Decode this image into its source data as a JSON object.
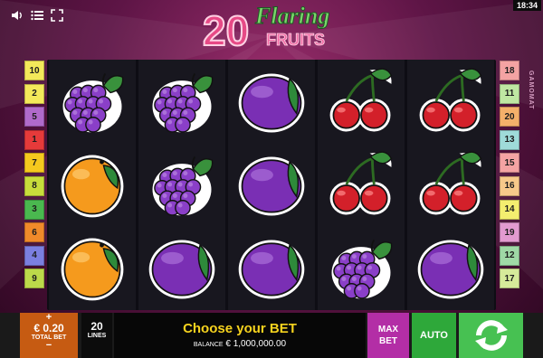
{
  "clock": "18:34",
  "logo": {
    "number": "20",
    "word1": "Flaring",
    "word2": "FRUITS"
  },
  "brand": "GAMOMAT",
  "left_lines": [
    {
      "n": "10",
      "color": "#f3e95a"
    },
    {
      "n": "2",
      "color": "#f3e95a"
    },
    {
      "n": "5",
      "color": "#b06acb"
    },
    {
      "n": "1",
      "color": "#e63a3a"
    },
    {
      "n": "7",
      "color": "#f5c81e"
    },
    {
      "n": "8",
      "color": "#c8dd3b"
    },
    {
      "n": "3",
      "color": "#4ab84f"
    },
    {
      "n": "6",
      "color": "#f08a2a"
    },
    {
      "n": "4",
      "color": "#7b7fe0"
    },
    {
      "n": "9",
      "color": "#bcd94a"
    }
  ],
  "right_lines": [
    {
      "n": "18",
      "color": "#f4a3a3"
    },
    {
      "n": "11",
      "color": "#bfe7a2"
    },
    {
      "n": "20",
      "color": "#f4b06a"
    },
    {
      "n": "13",
      "color": "#9fdbd9"
    },
    {
      "n": "15",
      "color": "#f4a3a3"
    },
    {
      "n": "16",
      "color": "#f7c98a"
    },
    {
      "n": "14",
      "color": "#f3ee6f"
    },
    {
      "n": "19",
      "color": "#e29ad0"
    },
    {
      "n": "12",
      "color": "#9fd8a6"
    },
    {
      "n": "17",
      "color": "#d6ea9a"
    }
  ],
  "reels": [
    [
      "grapes",
      "orange",
      "orange"
    ],
    [
      "grapes",
      "grapes",
      "plum"
    ],
    [
      "plum",
      "plum",
      "plum"
    ],
    [
      "cherries",
      "cherries",
      "grapes"
    ],
    [
      "cherries",
      "cherries",
      "plum"
    ]
  ],
  "bottom": {
    "plus": "+",
    "minus": "−",
    "bet_value": "€ 0.20",
    "bet_label": "TOTAL BET",
    "lines_value": "20",
    "lines_label": "LINES",
    "message": "Choose your BET",
    "balance_label": "BALANCE",
    "balance_value": "€ 1,000,000.00",
    "maxbet_line1": "MAX",
    "maxbet_line2": "BET",
    "auto_label": "AUTO"
  },
  "colors": {
    "bet": "#c65b12",
    "maxbet": "#b32ea6",
    "auto": "#2ea83a",
    "spin": "#47c152",
    "message": "#f6d31e"
  },
  "icons": [
    "sound-icon",
    "menu-icon",
    "fullscreen-icon",
    "spin-arrows-icon"
  ]
}
